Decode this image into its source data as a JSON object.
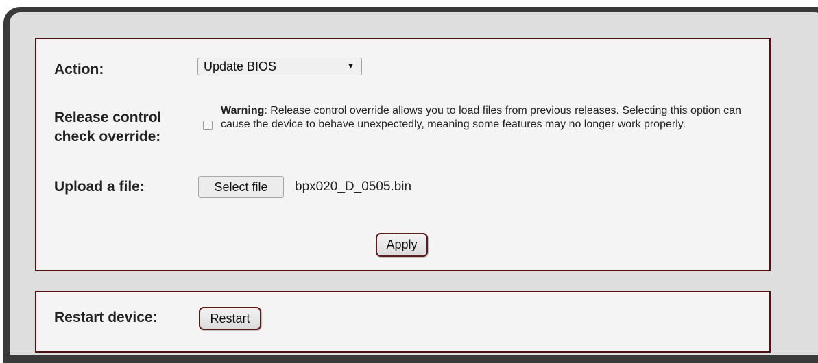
{
  "update_panel": {
    "action_label": "Action:",
    "action_selected": "Update BIOS",
    "release_label_line1": "Release control",
    "release_label_line2": "check override:",
    "warning_bold": "Warning",
    "warning_text": ": Release control override allows you to load files from previous releases. Selecting this option can cause the device to behave unexpectedly, meaning some features may no longer work properly.",
    "override_checked": false,
    "upload_label": "Upload a file:",
    "select_file_label": "Select file",
    "selected_filename": "bpx020_D_0505.bin",
    "apply_label": "Apply"
  },
  "restart_panel": {
    "restart_label": "Restart device:",
    "restart_button_label": "Restart"
  },
  "colors": {
    "panel_border": "#4f1010",
    "panel_background": "#f4f4f4",
    "frame_dark": "#3a3a3a",
    "frame_light": "#dedede"
  },
  "icons": {
    "select_arrow": "dropdown-arrow-icon"
  }
}
